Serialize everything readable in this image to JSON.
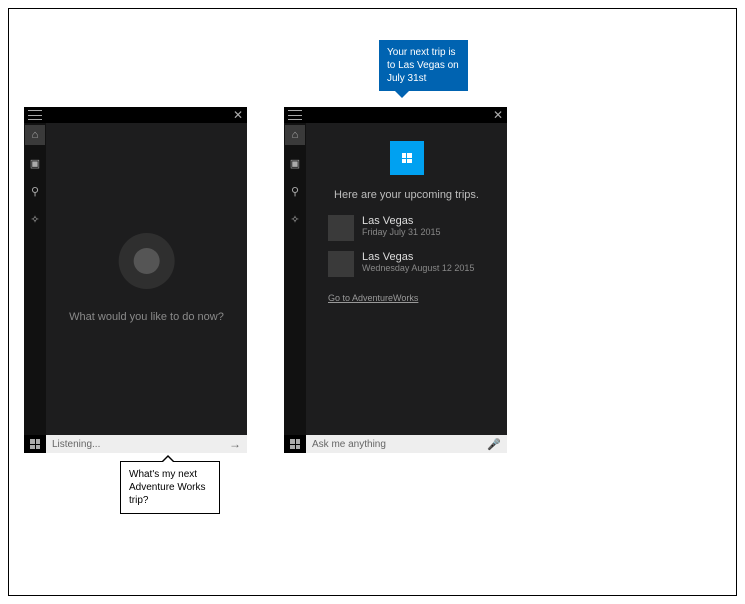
{
  "left_panel": {
    "prompt": "What would you like to do now?",
    "input_text": "Listening..."
  },
  "right_panel": {
    "heading": "Here are your upcoming trips.",
    "trips": [
      {
        "destination": "Las Vegas",
        "date": "Friday July 31 2015"
      },
      {
        "destination": "Las Vegas",
        "date": "Wednesday August 12 2015"
      }
    ],
    "go_link": "Go to AdventureWorks",
    "input_placeholder": "Ask me anything"
  },
  "callout_blue": "Your next trip is to Las Vegas on July 31st",
  "callout_white": "What's my next Adventure Works trip?"
}
